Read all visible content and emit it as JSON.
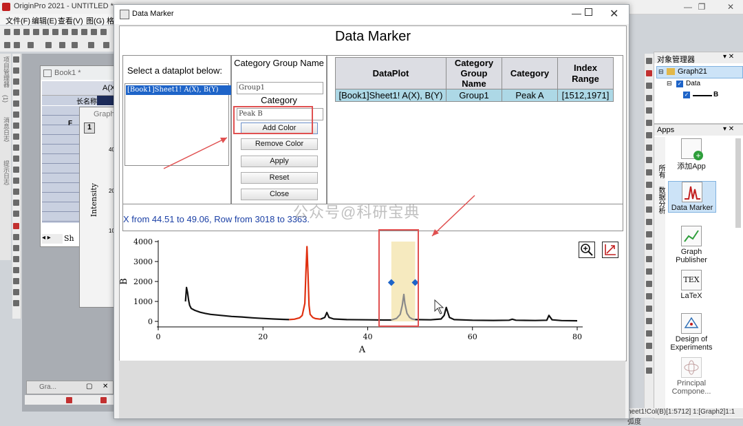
{
  "app": {
    "title": "OriginPro 2021 - UNTITLED *",
    "menu": [
      "文件(F)",
      "编辑(E)",
      "查看(V)",
      "图(G)",
      "格"
    ],
    "left_strip_labels": [
      "项目管理器",
      "(1)",
      "消息日志",
      "提示日志"
    ],
    "book1_title": "Book1 *",
    "book1_col_label": "A(X)",
    "book1_row_label": "长名称",
    "book1_f_label": "F",
    "graph_title": "Graph",
    "graph_layer": "1",
    "graph_ylabel": "Intensity",
    "graph_ticks": [
      "40",
      "20",
      "10"
    ],
    "sheet_tab": "Sh",
    "bottom_window": "Gra..."
  },
  "object_manager": {
    "title": "对象管理器",
    "graph_node": "Graph21",
    "data_node": "Data",
    "series_label": "B"
  },
  "apps_panel": {
    "title": "Apps",
    "tabs": [
      "所有",
      "数据分析"
    ],
    "items": [
      {
        "label": "添加App",
        "color": "#2e9e3b"
      },
      {
        "label": "Data Marker",
        "color": "#c21f1f"
      },
      {
        "label": "Graph Publisher",
        "color": "#2e9e3b"
      },
      {
        "label": "LaTeX",
        "color": "#555555"
      },
      {
        "label": "Design of Experiments",
        "color": "#2f6fb6"
      },
      {
        "label": "Principal Compone...",
        "color": "#c2a0a0"
      }
    ]
  },
  "status_bar_right": "heet1!Col(B)[1:5712] 1:[Graph2]1:1 弧度",
  "dialog": {
    "window_title": "Data Marker",
    "header": "Data Marker",
    "select_label": "Select a dataplot below:",
    "list_items": [
      "[Book1]Sheet1! A(X), B(Y)"
    ],
    "category_group_label": "Category Group Name",
    "category_group_value": "Group1",
    "category_label": "Category",
    "category_value": "Peak B",
    "buttons": {
      "add_color": "Add Color",
      "remove_color": "Remove Color",
      "apply": "Apply",
      "reset": "Reset",
      "close": "Close"
    },
    "table": {
      "headers": [
        "DataPlot",
        "Category Group Name",
        "Category",
        "Index Range"
      ],
      "rows": [
        [
          "[Book1]Sheet1! A(X), B(Y)",
          "Group1",
          "Peak A",
          "[1512,1971]"
        ]
      ]
    },
    "status": "X from 44.51 to 49.06, Row from 3018 to 3363.",
    "watermark": "公众号@科研宝典"
  },
  "chart_data": {
    "type": "line",
    "xlabel": "A",
    "ylabel": "B",
    "xlim": [
      0,
      80
    ],
    "ylim": [
      0,
      4000
    ],
    "xticks": [
      0,
      20,
      40,
      60,
      80
    ],
    "yticks": [
      0,
      1000,
      2000,
      3000,
      4000
    ],
    "series": [
      {
        "color": "#111111",
        "x": [
          5.2,
          5.4,
          5.6,
          5.8,
          6.0,
          6.3,
          7,
          8,
          9,
          10,
          12,
          14,
          16,
          18,
          20,
          22,
          24,
          25
        ],
        "y": [
          1000,
          1700,
          1450,
          1050,
          800,
          650,
          550,
          460,
          400,
          350,
          300,
          250,
          220,
          180,
          150,
          120,
          100,
          90
        ]
      },
      {
        "name": "Peak A",
        "color": "#e03010",
        "x": [
          25,
          26,
          27,
          27.5,
          28,
          28.2,
          28.4,
          28.6,
          28.8,
          29,
          29.5,
          30,
          31
        ],
        "y": [
          90,
          110,
          180,
          300,
          900,
          2500,
          3750,
          2400,
          800,
          350,
          200,
          140,
          110
        ]
      },
      {
        "color": "#111111",
        "x": [
          31,
          31.8,
          32.2,
          32.6,
          33.5,
          36,
          40,
          43,
          44.5
        ],
        "y": [
          110,
          200,
          450,
          200,
          120,
          90,
          80,
          70,
          70
        ]
      },
      {
        "name": "Peak B",
        "color": "#8a8a8a",
        "x": [
          44.5,
          45.5,
          46.2,
          46.6,
          46.9,
          47.1,
          47.5,
          48,
          48.5,
          49.06
        ],
        "y": [
          70,
          150,
          350,
          800,
          1350,
          900,
          400,
          200,
          120,
          90
        ]
      },
      {
        "color": "#111111",
        "x": [
          49.06,
          52,
          54,
          54.6,
          55,
          55.6,
          56.5,
          60,
          64,
          67,
          67.6,
          68.3,
          72,
          74.2,
          74.6,
          75.2,
          77,
          80
        ],
        "y": [
          90,
          80,
          120,
          300,
          700,
          200,
          90,
          60,
          50,
          60,
          110,
          60,
          45,
          60,
          300,
          80,
          40,
          30
        ]
      }
    ],
    "markers": [
      {
        "x": 44.51,
        "y": 1950
      },
      {
        "x": 49.06,
        "y": 1950
      }
    ],
    "selected_range": [
      44.51,
      49.06
    ]
  }
}
